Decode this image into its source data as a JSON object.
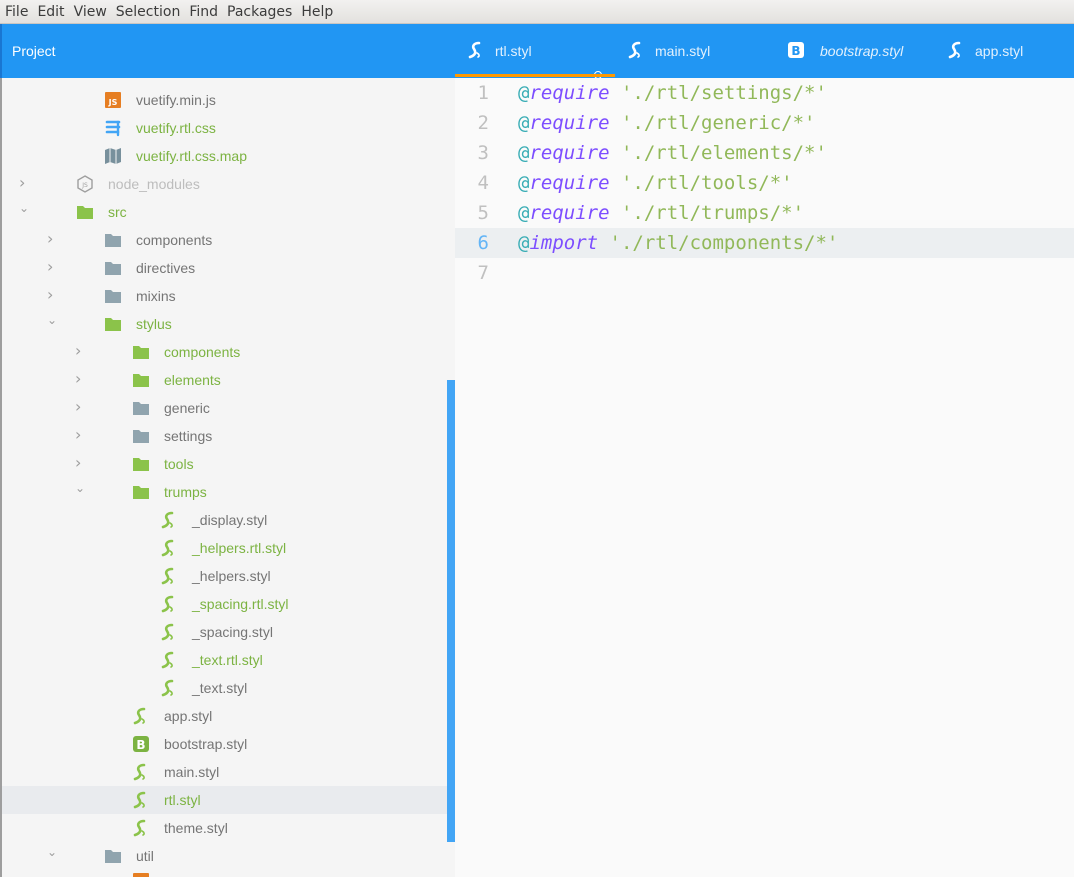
{
  "menubar": [
    "File",
    "Edit",
    "View",
    "Selection",
    "Find",
    "Packages",
    "Help"
  ],
  "header": {
    "project_title": "Project"
  },
  "tabs": [
    {
      "label": "rtl.styl",
      "icon": "stylus-icon",
      "active": true,
      "modified": true
    },
    {
      "label": "main.styl",
      "icon": "stylus-icon",
      "active": false
    },
    {
      "label": "bootstrap.styl",
      "icon": "bootstrap-icon",
      "active": false,
      "preview": true
    },
    {
      "label": "app.styl",
      "icon": "stylus-icon",
      "active": false
    }
  ],
  "tree": [
    {
      "label": "vuetify.min.js",
      "icon": "js-icon",
      "depth": 3
    },
    {
      "label": "vuetify.rtl.css",
      "icon": "css3-icon",
      "depth": 3,
      "modified": true
    },
    {
      "label": "vuetify.rtl.css.map",
      "icon": "map-icon",
      "depth": 3,
      "modified": true
    },
    {
      "label": "node_modules",
      "icon": "nodejs-icon",
      "depth": 2,
      "chevron": "collapsed",
      "ignored": true
    },
    {
      "label": "src",
      "icon": "folder-icon",
      "depth": 2,
      "chevron": "expanded",
      "modified": true
    },
    {
      "label": "components",
      "icon": "folder-icon",
      "depth": 3,
      "chevron": "collapsed"
    },
    {
      "label": "directives",
      "icon": "folder-icon",
      "depth": 3,
      "chevron": "collapsed"
    },
    {
      "label": "mixins",
      "icon": "folder-icon",
      "depth": 3,
      "chevron": "collapsed"
    },
    {
      "label": "stylus",
      "icon": "folder-icon",
      "depth": 3,
      "chevron": "expanded",
      "modified": true
    },
    {
      "label": "components",
      "icon": "folder-icon",
      "depth": 4,
      "chevron": "collapsed",
      "modified": true
    },
    {
      "label": "elements",
      "icon": "folder-icon",
      "depth": 4,
      "chevron": "collapsed",
      "modified": true
    },
    {
      "label": "generic",
      "icon": "folder-icon",
      "depth": 4,
      "chevron": "collapsed"
    },
    {
      "label": "settings",
      "icon": "folder-icon",
      "depth": 4,
      "chevron": "collapsed"
    },
    {
      "label": "tools",
      "icon": "folder-icon",
      "depth": 4,
      "chevron": "collapsed",
      "modified": true
    },
    {
      "label": "trumps",
      "icon": "folder-icon",
      "depth": 4,
      "chevron": "expanded",
      "modified": true
    },
    {
      "label": "_display.styl",
      "icon": "stylus-icon",
      "depth": 5
    },
    {
      "label": "_helpers.rtl.styl",
      "icon": "stylus-icon",
      "depth": 5,
      "modified": true
    },
    {
      "label": "_helpers.styl",
      "icon": "stylus-icon",
      "depth": 5
    },
    {
      "label": "_spacing.rtl.styl",
      "icon": "stylus-icon",
      "depth": 5,
      "modified": true
    },
    {
      "label": "_spacing.styl",
      "icon": "stylus-icon",
      "depth": 5
    },
    {
      "label": "_text.rtl.styl",
      "icon": "stylus-icon",
      "depth": 5,
      "modified": true
    },
    {
      "label": "_text.styl",
      "icon": "stylus-icon",
      "depth": 5
    },
    {
      "label": "app.styl",
      "icon": "stylus-icon",
      "depth": 4
    },
    {
      "label": "bootstrap.styl",
      "icon": "bootstrap-icon",
      "depth": 4
    },
    {
      "label": "main.styl",
      "icon": "stylus-icon",
      "depth": 4
    },
    {
      "label": "rtl.styl",
      "icon": "stylus-icon",
      "depth": 4,
      "modified": true,
      "selected": true
    },
    {
      "label": "theme.styl",
      "icon": "stylus-icon",
      "depth": 4
    },
    {
      "label": "util",
      "icon": "folder-icon",
      "depth": 3,
      "chevron": "expanded"
    }
  ],
  "editor": {
    "current_line": 6,
    "lines": [
      {
        "num": "1",
        "tokens": [
          [
            "at",
            "@"
          ],
          [
            "kw",
            "require"
          ],
          [
            "plain",
            " "
          ],
          [
            "str",
            "'./rtl/settings/*'"
          ]
        ]
      },
      {
        "num": "2",
        "tokens": [
          [
            "at",
            "@"
          ],
          [
            "kw",
            "require"
          ],
          [
            "plain",
            " "
          ],
          [
            "str",
            "'./rtl/generic/*'"
          ]
        ]
      },
      {
        "num": "3",
        "tokens": [
          [
            "at",
            "@"
          ],
          [
            "kw",
            "require"
          ],
          [
            "plain",
            " "
          ],
          [
            "str",
            "'./rtl/elements/*'"
          ]
        ]
      },
      {
        "num": "4",
        "tokens": [
          [
            "at",
            "@"
          ],
          [
            "kw",
            "require"
          ],
          [
            "plain",
            " "
          ],
          [
            "str",
            "'./rtl/tools/*'"
          ]
        ]
      },
      {
        "num": "5",
        "tokens": [
          [
            "at",
            "@"
          ],
          [
            "kw",
            "require"
          ],
          [
            "plain",
            " "
          ],
          [
            "str",
            "'./rtl/trumps/*'"
          ]
        ]
      },
      {
        "num": "6",
        "tokens": [
          [
            "at",
            "@"
          ],
          [
            "kw",
            "import"
          ],
          [
            "plain",
            " "
          ],
          [
            "str",
            "'./rtl/components/*'"
          ]
        ]
      },
      {
        "num": "7",
        "tokens": []
      }
    ]
  },
  "colors": {
    "header_bg": "#2196f3",
    "active_tab_underline": "#ff9800",
    "modified_file": "#7cb342",
    "folder": "#90a4ae",
    "folder_modified": "#8bc34a",
    "stylus_icon": "#8bc34a",
    "js_icon": "#e67e22",
    "css_icon": "#42a5f5",
    "scrollbar": "#42a5f5"
  }
}
